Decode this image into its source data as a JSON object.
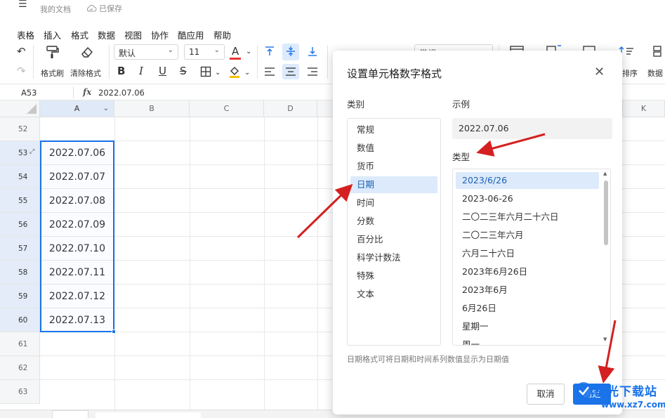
{
  "app": {
    "doc_title": "我的文档",
    "save_status": "已保存"
  },
  "menu": [
    "表格",
    "插入",
    "格式",
    "数据",
    "视图",
    "协作",
    "酷应用",
    "帮助"
  ],
  "toolbar": {
    "format_painter": "格式刷",
    "clear_format": "清除格式",
    "font": "默认",
    "font_size": "11",
    "partial_right": [
      "常规",
      "排序",
      "数据"
    ]
  },
  "formula_bar": {
    "cell_ref": "A53",
    "fx": "fx",
    "value": "2022.07.06"
  },
  "grid": {
    "columns": [
      "A",
      "B",
      "C",
      "D",
      "K"
    ],
    "rows": [
      {
        "num": "52",
        "value": ""
      },
      {
        "num": "53",
        "value": "2022.07.06"
      },
      {
        "num": "54",
        "value": "2022.07.07"
      },
      {
        "num": "55",
        "value": "2022.07.08"
      },
      {
        "num": "56",
        "value": "2022.07.09"
      },
      {
        "num": "57",
        "value": "2022.07.10"
      },
      {
        "num": "58",
        "value": "2022.07.11"
      },
      {
        "num": "59",
        "value": "2022.07.12"
      },
      {
        "num": "60",
        "value": "2022.07.13"
      },
      {
        "num": "61",
        "value": ""
      },
      {
        "num": "62",
        "value": ""
      },
      {
        "num": "63",
        "value": ""
      }
    ]
  },
  "dialog": {
    "title": "设置单元格数字格式",
    "category_label": "类别",
    "categories": [
      "常规",
      "数值",
      "货币",
      "日期",
      "时间",
      "分数",
      "百分比",
      "科学计数法",
      "特殊",
      "文本"
    ],
    "selected_category": "日期",
    "example_label": "示例",
    "example_value": "2022.07.06",
    "type_label": "类型",
    "types": [
      "2023/6/26",
      "2023-06-26",
      "二〇二三年六月二十六日",
      "二〇二三年六月",
      "六月二十六日",
      "2023年6月26日",
      "2023年6月",
      "6月26日",
      "星期一",
      "周一"
    ],
    "selected_type": "2023/6/26",
    "description": "日期格式可将日期和时间系列数值显示为日期值",
    "cancel_label": "取消",
    "ok_label": "确定"
  },
  "watermark": {
    "text": "极光下载站",
    "url": "www.xz7.com"
  },
  "colors": {
    "accent": "#1a73e8",
    "arrow": "#d42020",
    "selected_bg": "#dceafb"
  }
}
